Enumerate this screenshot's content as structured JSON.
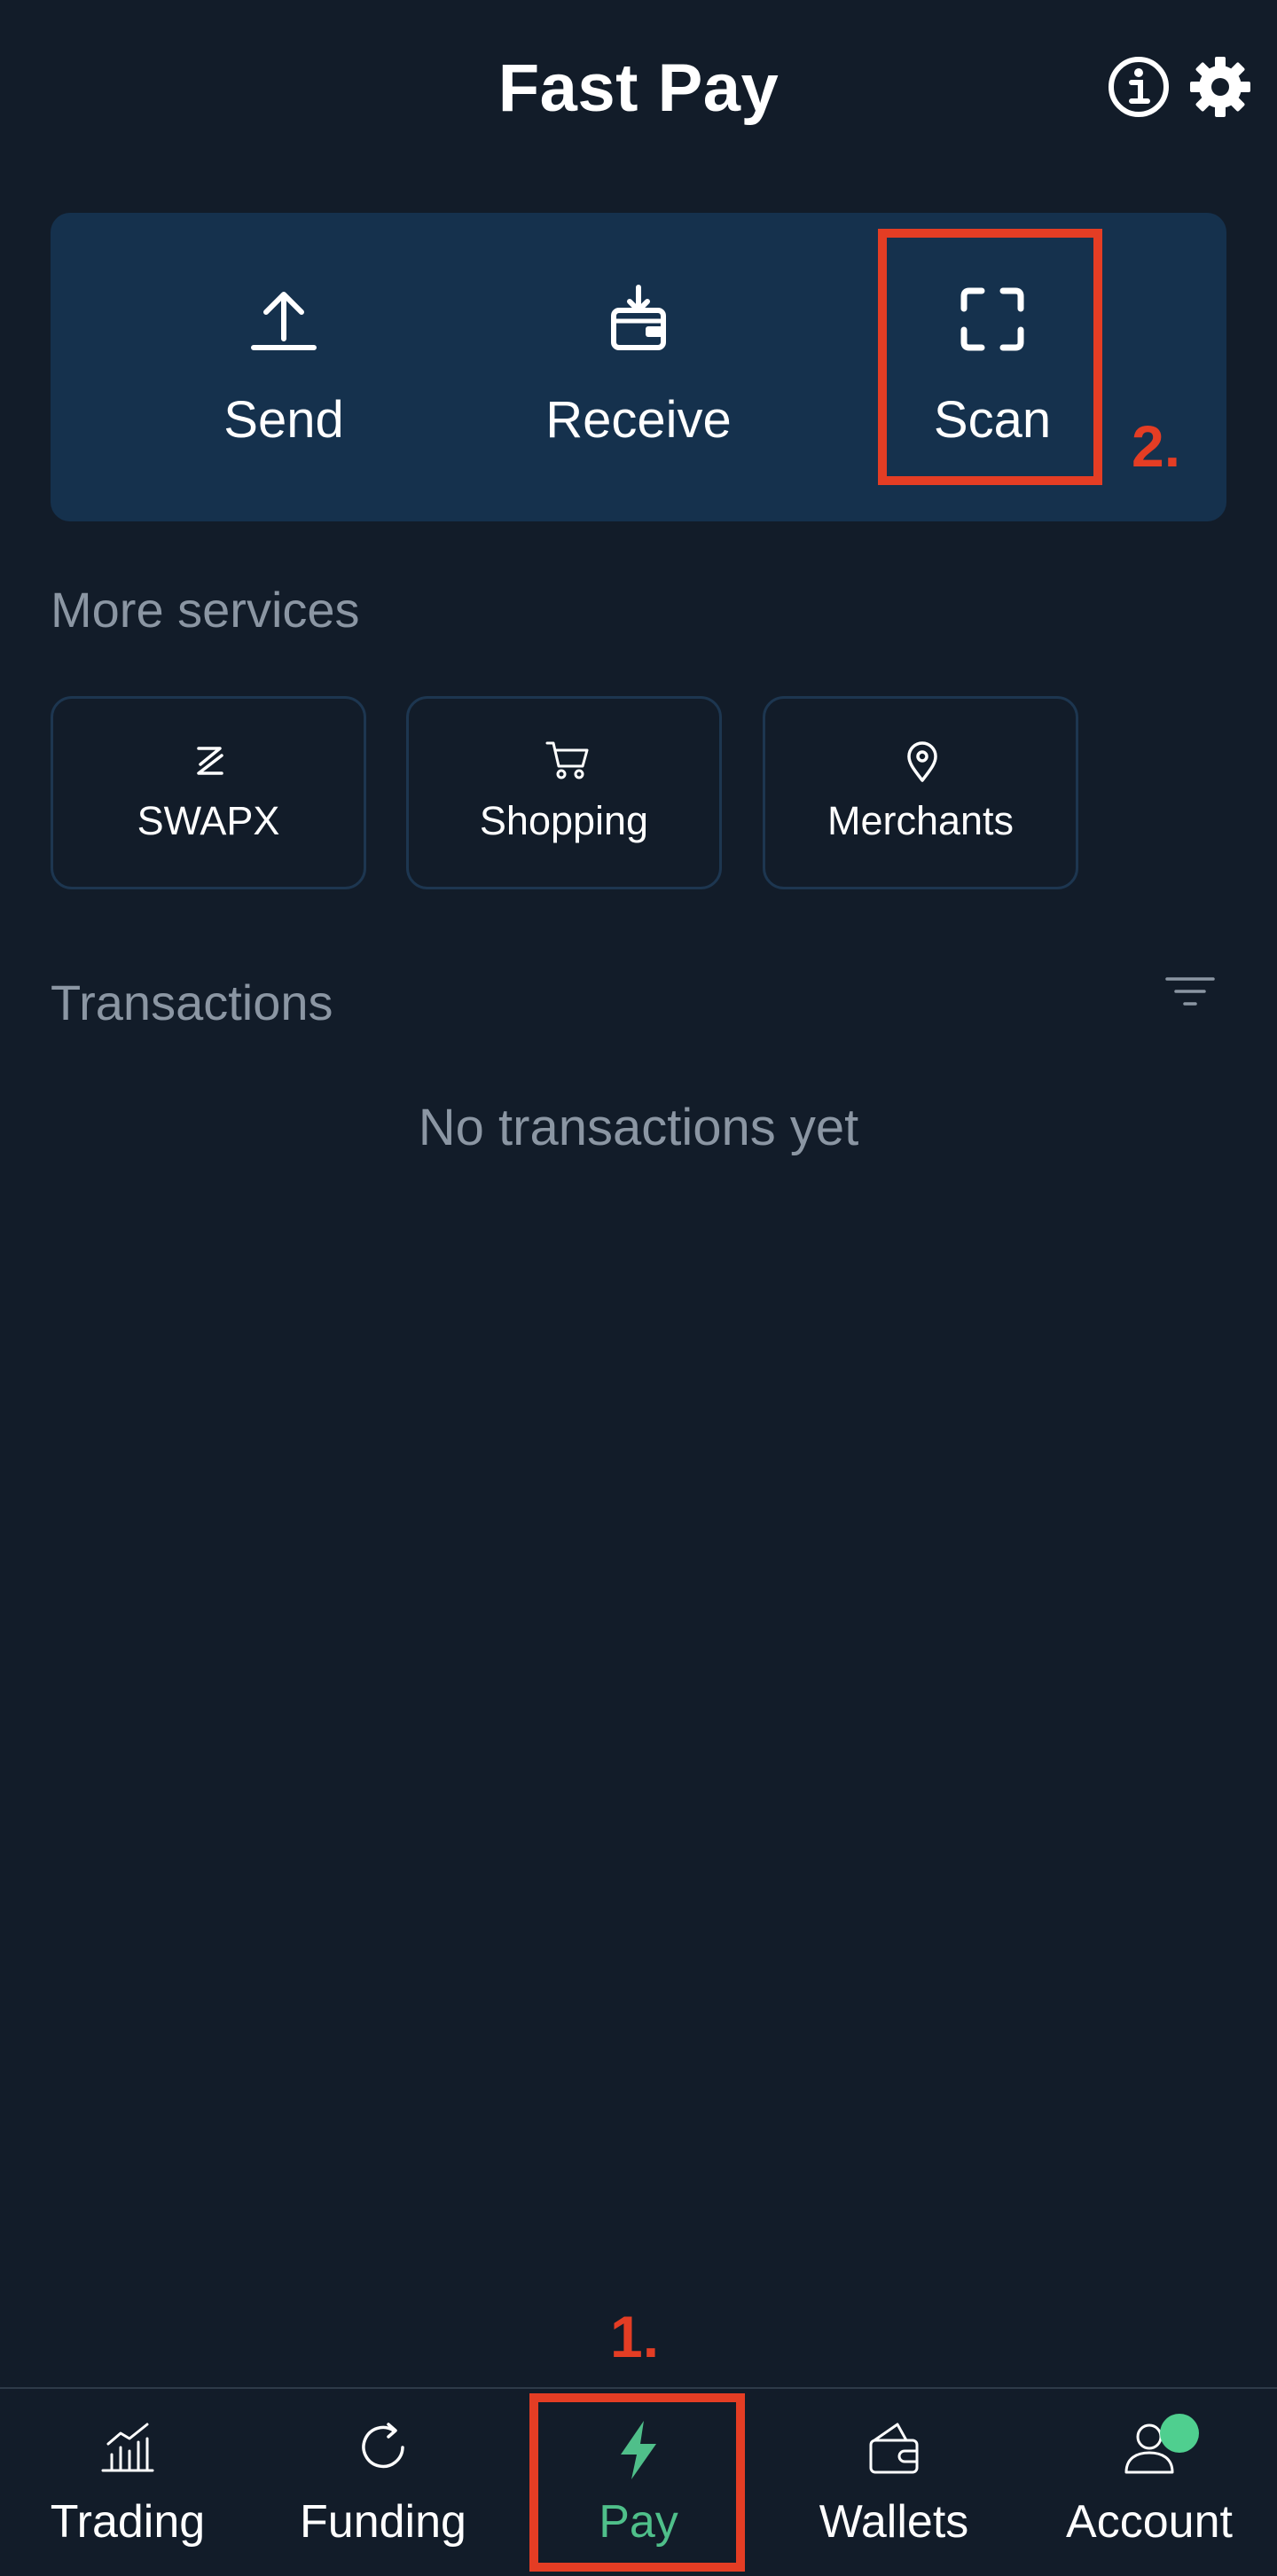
{
  "header": {
    "title": "Fast Pay",
    "info_icon": "info-icon",
    "settings_icon": "gear-icon"
  },
  "actions": [
    {
      "label": "Send",
      "icon": "upload-icon"
    },
    {
      "label": "Receive",
      "icon": "receive-wallet-icon"
    },
    {
      "label": "Scan",
      "icon": "scan-frame-icon"
    }
  ],
  "services": {
    "title": "More services",
    "items": [
      {
        "label": "SWAPX",
        "icon": "swap-logo-icon"
      },
      {
        "label": "Shopping",
        "icon": "cart-icon"
      },
      {
        "label": "Merchants",
        "icon": "location-pin-icon"
      }
    ]
  },
  "transactions": {
    "title": "Transactions",
    "empty_text": "No transactions yet",
    "filter_icon": "filter-icon"
  },
  "annotations": [
    {
      "number": "1.",
      "color": "#e43d24"
    },
    {
      "number": "2.",
      "color": "#e43d24"
    }
  ],
  "bottom_nav": {
    "active": "Pay",
    "active_color": "#4fbf8a",
    "items": [
      {
        "label": "Trading",
        "icon": "chart-icon"
      },
      {
        "label": "Funding",
        "icon": "refresh-icon"
      },
      {
        "label": "Pay",
        "icon": "lightning-icon"
      },
      {
        "label": "Wallets",
        "icon": "wallet-icon"
      },
      {
        "label": "Account",
        "icon": "user-icon",
        "badge_color": "#4fcf8f"
      }
    ]
  },
  "colors": {
    "background": "#121c29",
    "card": "#15314d",
    "muted_text": "#8b96a3",
    "accent_green": "#4fbf8a"
  }
}
